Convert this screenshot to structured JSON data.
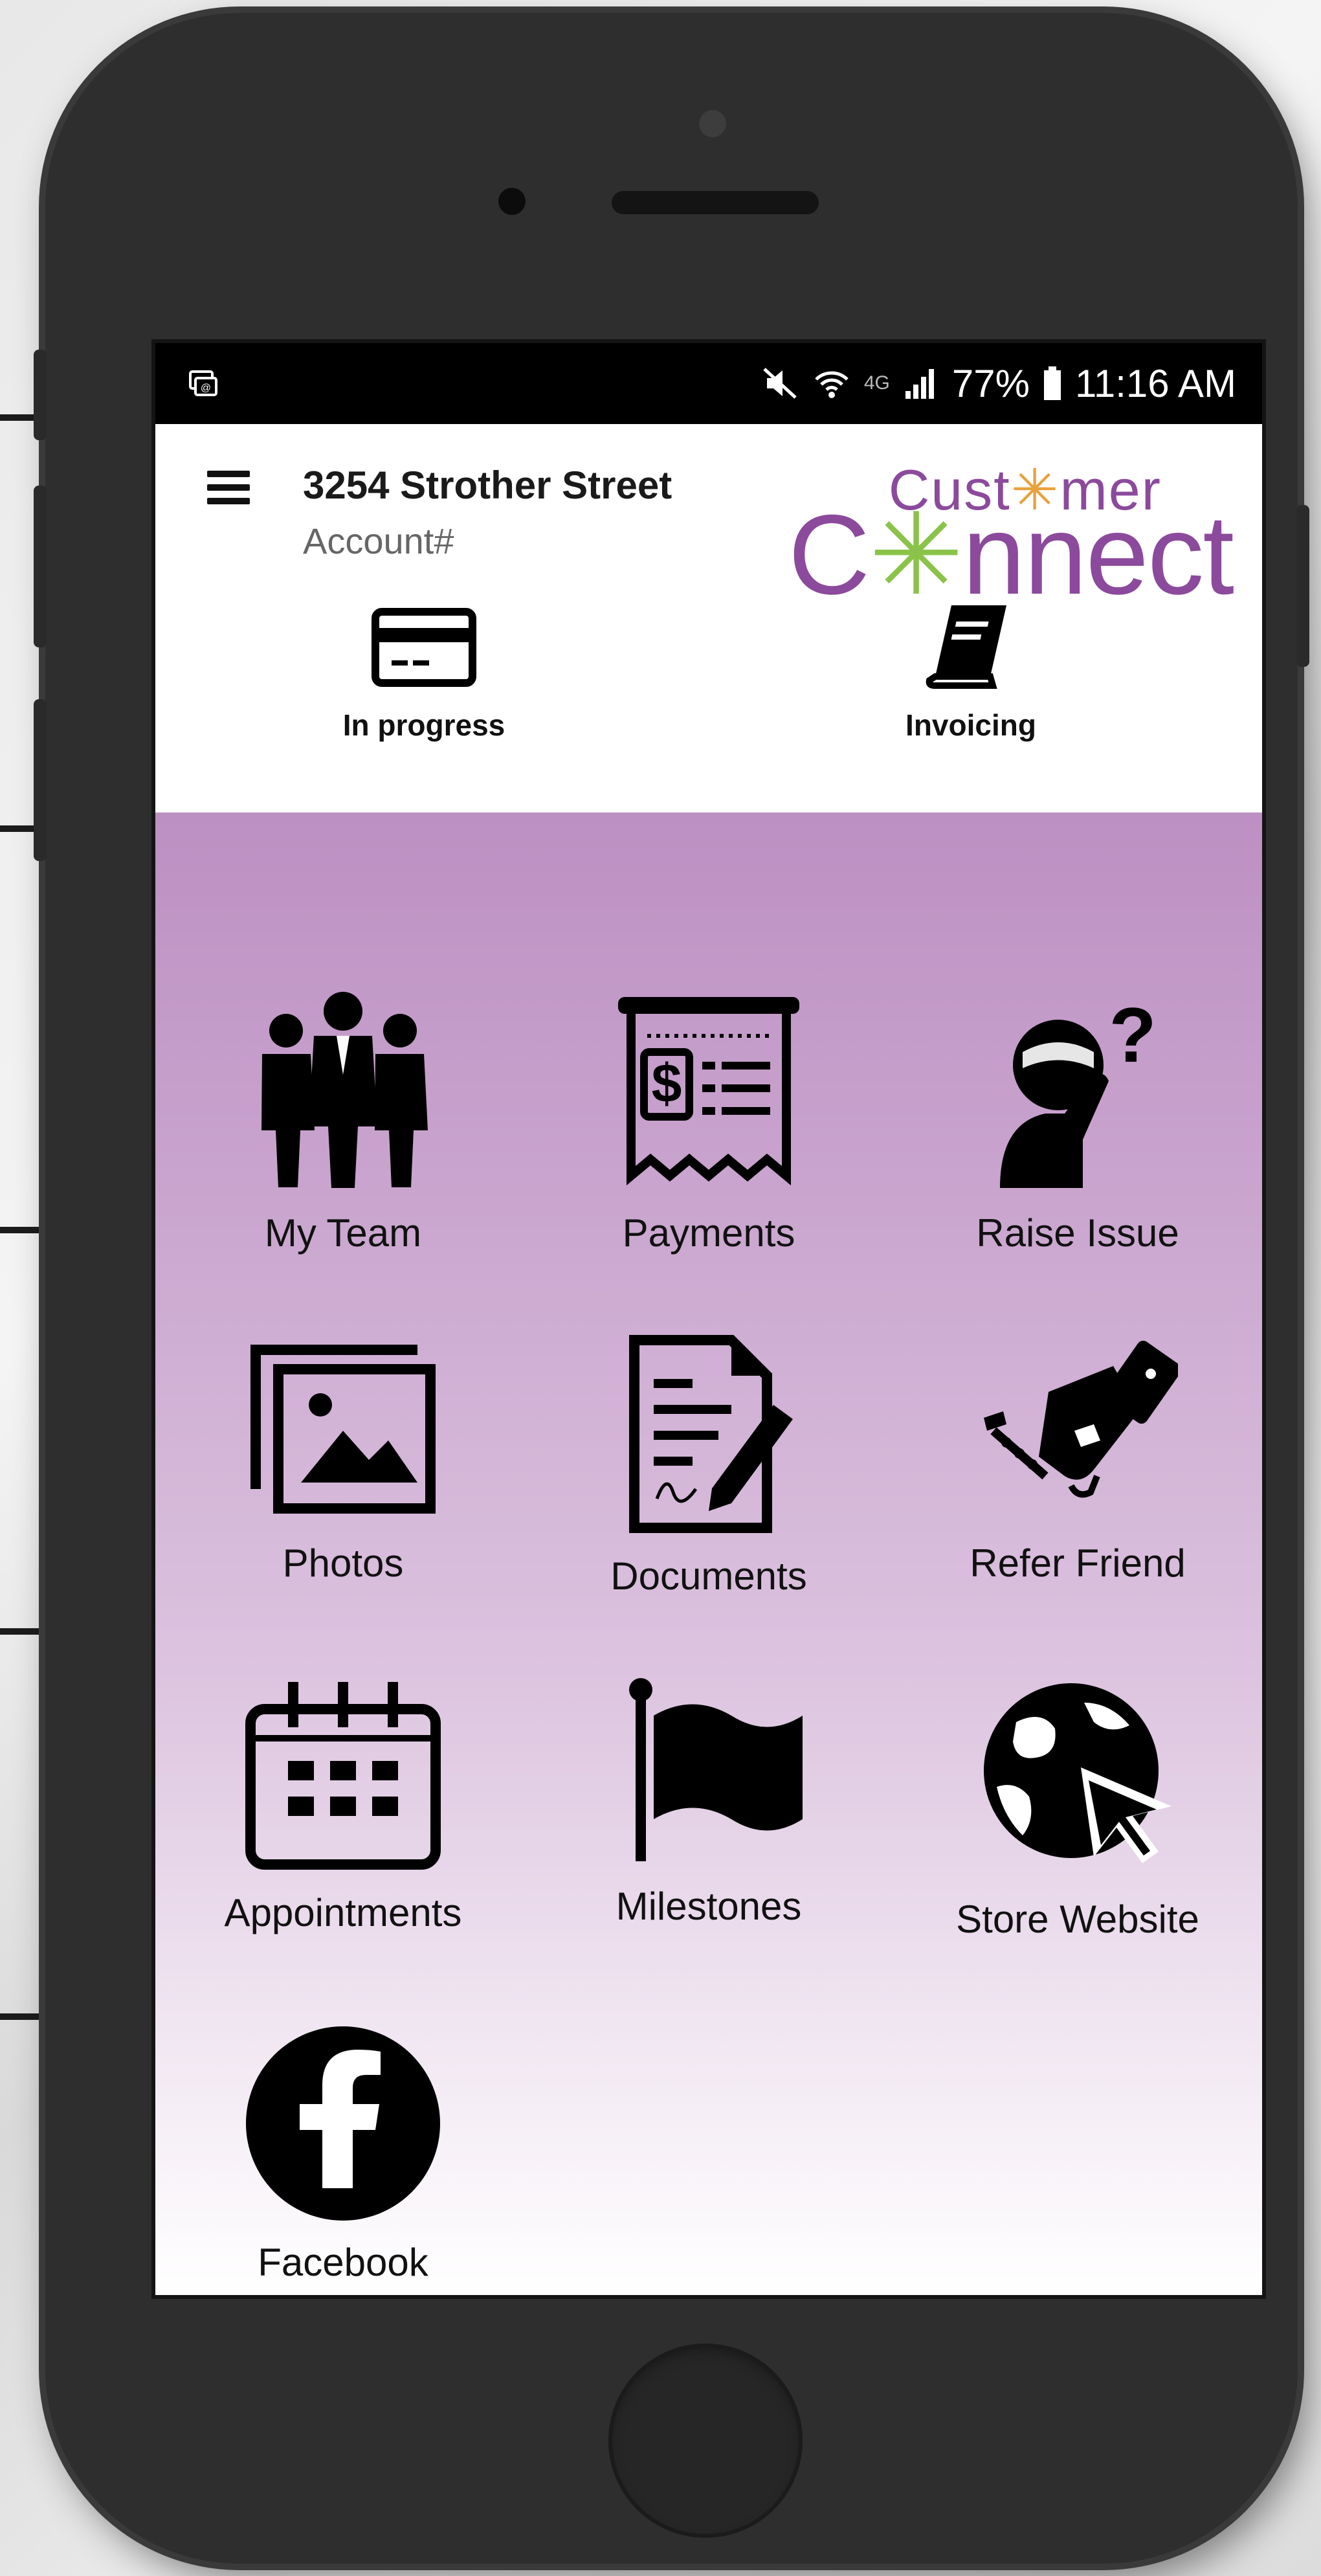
{
  "status_bar": {
    "notification_icon": "screen-mirror-icon",
    "network": "4G",
    "battery": "77%",
    "time": "11:16 AM"
  },
  "header": {
    "address": "3254 Strother Street",
    "account_label": "Account#",
    "menu_icon": "hamburger-menu-icon"
  },
  "logo": {
    "line1_prefix": "Cust",
    "line1_star": "✳",
    "line1_suffix": "mer",
    "line2_prefix": "C",
    "line2_star": "✳",
    "line2_suffix": "nnect",
    "purple": "#8b4a9c",
    "green": "#8bc34a"
  },
  "quick_actions": [
    {
      "label": "In progress",
      "icon": "credit-card-icon"
    },
    {
      "label": "Invoicing",
      "icon": "book-icon"
    }
  ],
  "tiles": [
    {
      "label": "My Team",
      "icon": "team-icon"
    },
    {
      "label": "Payments",
      "icon": "receipt-icon"
    },
    {
      "label": "Raise Issue",
      "icon": "question-person-icon"
    },
    {
      "label": "Photos",
      "icon": "photos-icon"
    },
    {
      "label": "Documents",
      "icon": "document-pen-icon"
    },
    {
      "label": "Refer Friend",
      "icon": "handshake-icon"
    },
    {
      "label": "Appointments",
      "icon": "calendar-icon"
    },
    {
      "label": "Milestones",
      "icon": "flag-icon"
    },
    {
      "label": "Store Website",
      "icon": "globe-cursor-icon"
    },
    {
      "label": "Facebook",
      "icon": "facebook-icon"
    }
  ],
  "colors": {
    "purple_top": "#b98bbf",
    "purple_bottom": "#ffffff",
    "status_bar": "#000000"
  }
}
